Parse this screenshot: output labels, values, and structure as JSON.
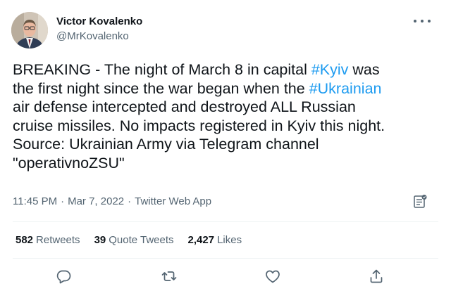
{
  "tweet": {
    "author": {
      "display_name": "Victor Kovalenko",
      "handle": "@MrKovalenko"
    },
    "body": {
      "t1": "BREAKING - The night of March 8 in capital ",
      "h1": "#Kyiv",
      "t2": " was\nthe first night since the war began when the ",
      "h2": "#Ukrainian",
      "t3": "\nair defense intercepted and destroyed ALL Russian\ncruise missiles. No impacts registered in Kyiv this night.\nSource: Ukrainian Army via Telegram channel\n\"operativnoZSU\""
    },
    "meta": {
      "time": "11:45 PM",
      "date": "Mar 7, 2022",
      "separator": "·",
      "source": "Twitter Web App"
    },
    "stats": {
      "retweets_count": "582",
      "retweets_label": "Retweets",
      "quotes_count": "39",
      "quotes_label": "Quote Tweets",
      "likes_count": "2,427",
      "likes_label": "Likes"
    },
    "icons": {
      "more": "more-horizontal-icon",
      "analytics": "analytics-icon",
      "reply": "reply-icon",
      "retweet": "retweet-icon",
      "like": "heart-icon",
      "share": "share-icon"
    }
  },
  "colors": {
    "text": "#0f1419",
    "secondary": "#536471",
    "link": "#1d9bf0",
    "divider": "#eff3f4"
  }
}
